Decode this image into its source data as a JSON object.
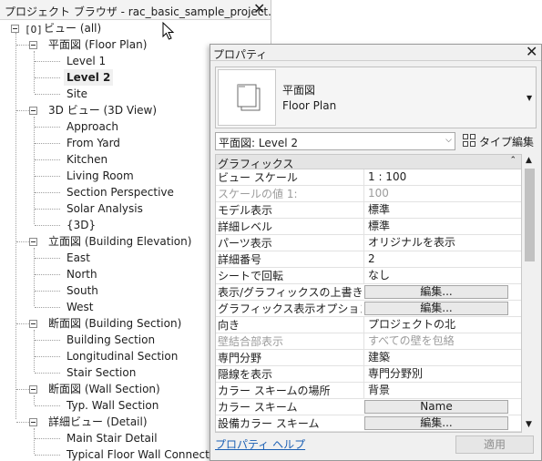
{
  "browser": {
    "title": "プロジェクト ブラウザ - rac_basic_sample_project.rvt",
    "close": "✕",
    "root": "ビュー (all)",
    "groups": [
      {
        "label": "平面図 (Floor Plan)",
        "items": [
          "Level 1",
          "Level 2",
          "Site"
        ]
      },
      {
        "label": "3D ビュー (3D View)",
        "items": [
          "Approach",
          "From Yard",
          "Kitchen",
          "Living Room",
          "Section Perspective",
          "Solar Analysis",
          "{3D}"
        ]
      },
      {
        "label": "立面図 (Building Elevation)",
        "items": [
          "East",
          "North",
          "South",
          "West"
        ]
      },
      {
        "label": "断面図 (Building Section)",
        "items": [
          "Building Section",
          "Longitudinal Section",
          "Stair Section"
        ]
      },
      {
        "label": "断面図 (Wall Section)",
        "items": [
          "Typ. Wall Section"
        ]
      },
      {
        "label": "詳細ビュー (Detail)",
        "items": [
          "Main Stair Detail",
          "Typical Floor Wall Connection"
        ]
      }
    ],
    "selected_item": "Level 2"
  },
  "properties": {
    "title": "プロパティ",
    "close": "✕",
    "type_family": "平面図",
    "type_name": "Floor Plan",
    "instance_selector": "平面図: Level 2",
    "edit_type_label": "タイプ編集",
    "group_label": "グラフィックス",
    "rows": [
      {
        "name": "ビュー スケール",
        "value": "1 : 100"
      },
      {
        "name": "スケールの値    1:",
        "value": "100",
        "dim": true
      },
      {
        "name": "モデル表示",
        "value": "標準"
      },
      {
        "name": "詳細レベル",
        "value": "標準"
      },
      {
        "name": "パーツ表示",
        "value": "オリジナルを表示"
      },
      {
        "name": "詳細番号",
        "value": "2"
      },
      {
        "name": "シートで回転",
        "value": "なし"
      },
      {
        "name": "表示/グラフィックスの上書き",
        "value": "編集...",
        "button": true
      },
      {
        "name": "グラフィックス表示オプション",
        "value": "編集...",
        "button": true
      },
      {
        "name": "向き",
        "value": "プロジェクトの北"
      },
      {
        "name": "壁結合部表示",
        "value": "すべての壁を包絡",
        "dim": true
      },
      {
        "name": "専門分野",
        "value": "建築"
      },
      {
        "name": "隠線を表示",
        "value": "専門分野別"
      },
      {
        "name": "カラー スキームの場所",
        "value": "背景"
      },
      {
        "name": "カラー スキーム",
        "value": "Name",
        "button": true
      },
      {
        "name": "設備カラー スキーム",
        "value": "編集...",
        "button": true
      }
    ],
    "help_link": "プロパティ ヘルプ",
    "apply_label": "適用"
  }
}
